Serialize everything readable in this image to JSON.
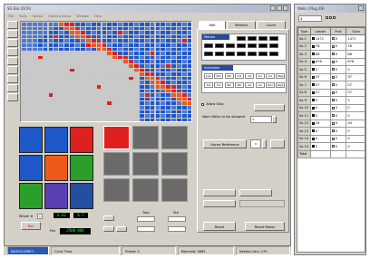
{
  "main_window": {
    "title": "SG Bio (OCR)",
    "menu": [
      "File",
      "Tools",
      "Option",
      "Camera Setup",
      "Window",
      "Help"
    ]
  },
  "palette": {
    "red": "#e02020",
    "blue": "#1f58c8",
    "orange": "#ee5a1a",
    "green": "#2aa02a",
    "purple": "#5a3fb0",
    "dark_blue": "#244fa0",
    "grey": "#6a6a6a",
    "well_light": "#4a79d8"
  },
  "grid_tiles": [
    {
      "name": "tile-blue-1",
      "color": "blue"
    },
    {
      "name": "tile-blue-2",
      "color": "blue"
    },
    {
      "name": "tile-red",
      "color": "red"
    },
    {
      "name": "tile-blue-3",
      "color": "blue"
    },
    {
      "name": "tile-orange",
      "color": "orange"
    },
    {
      "name": "tile-green-1",
      "color": "green"
    },
    {
      "name": "tile-green-2",
      "color": "green"
    },
    {
      "name": "tile-purple",
      "color": "purple"
    },
    {
      "name": "tile-dark-blue",
      "color": "dark_blue"
    }
  ],
  "preview_tiles": [
    {
      "color": "red"
    },
    {
      "color": "grey"
    },
    {
      "color": "grey"
    },
    {
      "color": "grey"
    },
    {
      "color": "grey"
    },
    {
      "color": "grey"
    },
    {
      "color": "grey"
    },
    {
      "color": "grey"
    },
    {
      "color": "grey"
    }
  ],
  "controls": {
    "wheel_label": "Wheel #",
    "wheel_value": "1",
    "run_label": "Run",
    "display_a": "6.62",
    "display_b": "6.7",
    "pos_label": "Pos",
    "display_c": "2588 888",
    "trap_label": "Trap",
    "ste_label": "Ste"
  },
  "tabs": [
    "Wet",
    "Method",
    "Cover"
  ],
  "motors": {
    "header": "Motors"
  },
  "solenoids": {
    "header": "Solenoids",
    "row1": [
      "Jaw",
      "Shk",
      "Wk",
      "Irle",
      "sol",
      "sol",
      "sol",
      "Wag"
    ],
    "row2": [
      "Sol",
      "Sol",
      "Wk",
      "Wk",
      "sol",
      "sol",
      "Tsol",
      "Wg2"
    ]
  },
  "allow_skip": {
    "label": "Allow Skip",
    "wells_label": "Nam Wells to be skipped",
    "wells_value": "3"
  },
  "home_button": "Home Reference",
  "home_value": "0",
  "bottom_buttons": {
    "reset": "Reset",
    "reset_motor": "Reset Motor"
  },
  "status_bar": {
    "mode": "MATCH-VERIFY",
    "cycle": "Cycle Time:",
    "picked": "Picked: 0",
    "rejected": "Rejected: 5865",
    "needle": "Needle-Intrx: 279"
  },
  "side_window": {
    "title": "Wells (Plug 49)",
    "combo_value": "4",
    "columns": [
      "Type",
      "Leader",
      "Pcat",
      "Scan"
    ],
    "rows": [
      {
        "type": "Sa 1",
        "color": "#ee3a3a",
        "leader": "1471",
        "pcat": "0",
        "scan": "1471"
      },
      {
        "type": "Sa 2",
        "color": "#ee3a3a",
        "leader": "78",
        "pcat": "0",
        "scan": "78"
      },
      {
        "type": "Sa 3",
        "color": "#3aa63a",
        "leader": "88",
        "pcat": "0",
        "scan": "88"
      },
      {
        "type": "Sa 4",
        "color": "#ee3a3a",
        "leader": "676",
        "pcat": "0",
        "scan": "676"
      },
      {
        "type": "Sa 5",
        "color": "#2a4fc8",
        "leader": "5",
        "pcat": "0",
        "scan": "5"
      },
      {
        "type": "Sa 6",
        "color": "#e6d84a",
        "leader": "37",
        "pcat": "0",
        "scan": "37"
      },
      {
        "type": "Sa 7",
        "color": "#ee3a3a",
        "leader": "07",
        "pcat": "0",
        "scan": "07"
      },
      {
        "type": "Sa 8",
        "color": "#3aa63a",
        "leader": "07",
        "pcat": "0",
        "scan": "07"
      },
      {
        "type": "Sa 9",
        "color": "#2a4fc8",
        "leader": "5",
        "pcat": "0",
        "scan": "5"
      },
      {
        "type": "Sa 10",
        "color": "#6a3ab0",
        "leader": "0",
        "pcat": "0",
        "scan": "0"
      },
      {
        "type": "Sa 11",
        "color": "#2a4fc8",
        "leader": "0",
        "pcat": "0",
        "scan": "0"
      },
      {
        "type": "Sa 12",
        "color": "#ee3a3a",
        "leader": "34",
        "pcat": "0",
        "scan": "34"
      },
      {
        "type": "Sa 13",
        "color": "#3aa63a",
        "leader": "0",
        "pcat": "0",
        "scan": "0"
      },
      {
        "type": "Sa 14",
        "color": "#2a4fc8",
        "leader": "0",
        "pcat": "0",
        "scan": "0"
      },
      {
        "type": "Sa 15",
        "color": "#111111",
        "leader": "0",
        "pcat": "0",
        "scan": "0"
      },
      {
        "type": "Total",
        "color": "",
        "leader": "",
        "pcat": "",
        "scan": ""
      }
    ]
  }
}
